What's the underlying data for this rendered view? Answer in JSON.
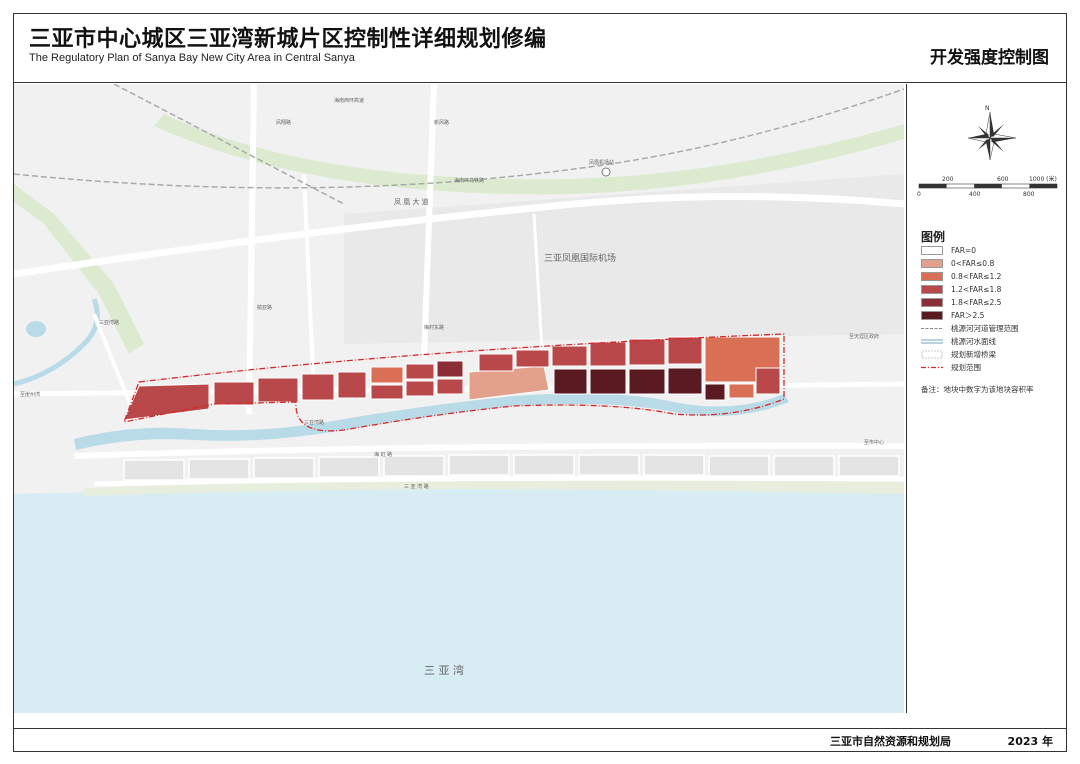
{
  "header": {
    "title_zh": "三亚市中心城区三亚湾新城片区控制性详细规划修编",
    "title_en": "The Regulatory Plan of Sanya Bay New City Area in Central Sanya",
    "map_name": "开发强度控制图"
  },
  "footer": {
    "agency": "三亚市自然资源和规划局",
    "year": "2023 年"
  },
  "compass": {
    "north_label": "N"
  },
  "scale_bar": {
    "top_ticks": [
      "200",
      "600",
      "1000 (米)"
    ],
    "bottom_ticks": [
      "0",
      "400",
      "800"
    ]
  },
  "legend": {
    "title": "图例",
    "items": [
      {
        "label": "FAR=0",
        "color": "#ffffff"
      },
      {
        "label": "0<FAR≤0.8",
        "color": "#e3a08a"
      },
      {
        "label": "0.8<FAR≤1.2",
        "color": "#d96f55"
      },
      {
        "label": "1.2<FAR≤1.8",
        "color": "#b8484a"
      },
      {
        "label": "1.8<FAR≤2.5",
        "color": "#8a2d36"
      },
      {
        "label": "FAR＞2.5",
        "color": "#5a1a22"
      },
      {
        "label": "桃源河河道管理范围",
        "color": ""
      },
      {
        "label": "桃源河水面线",
        "color": ""
      },
      {
        "label": "规划新增桥梁",
        "color": ""
      },
      {
        "label": "规划范围",
        "color": ""
      }
    ],
    "note": "备注：地块中数字为该地块容积率"
  },
  "map_labels": {
    "airport": "三亚凤凰国际机场",
    "bay": "三 亚 湾",
    "avenue": "凤 凰 大 道",
    "rail": "海南环岛铁路",
    "highway": "海南西环高速",
    "station": "凤凰机场站",
    "road_right_1": "至天涯区政府",
    "road_right_2": "至市中心",
    "road_left": "至崖州湾",
    "road_v1": "榆亚路",
    "road_v2": "凤翔路",
    "road_v3": "梅村东路",
    "road_v4": "新风路",
    "road_v5": "三亚湾路",
    "road_diag": "三亚湾路",
    "road_s1": "海 虹 路",
    "road_s2": "三 亚 湾 路"
  },
  "colors": {
    "water": "#d8ecf4",
    "river": "#b9dbe8",
    "green": "#dcebcf",
    "far_0_8": "#e3a08a",
    "far_1_2": "#d96f55",
    "far_1_8": "#b8484a",
    "far_2_5": "#8a2d36",
    "far_max": "#5a1a22",
    "boundary": "#d42a2a"
  }
}
